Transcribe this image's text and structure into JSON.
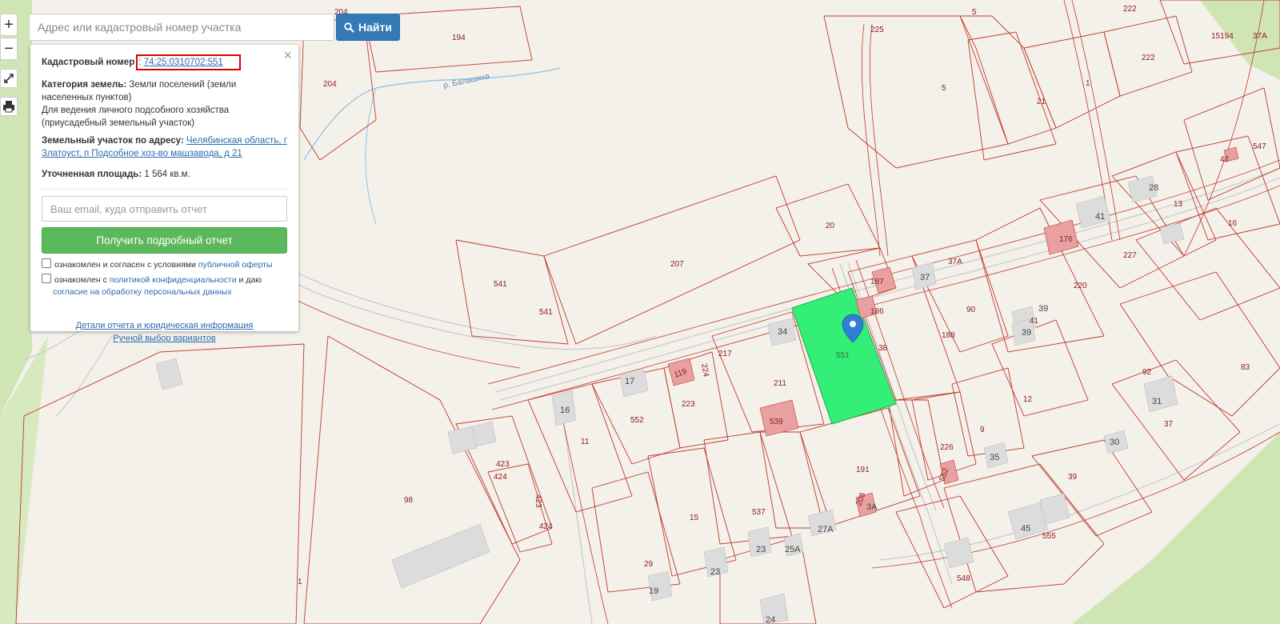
{
  "search": {
    "placeholder": "Адрес или кадастровый номер участка",
    "button_label": "Найти"
  },
  "controls": {
    "zoom_in": "+",
    "zoom_out": "−"
  },
  "panel": {
    "close_symbol": "×",
    "cadastral_label": "Кадастровый номер",
    "cadastral_number": "74:25:0310702:551",
    "land_category_label": "Категория земель:",
    "land_category_value": "Земли поселений (земли населенных пунктов)",
    "land_use": "Для ведения личного подсобного хозяйства (приусадебный земельный участок)",
    "address_label": "Земельный участок по адресу:",
    "address_link": "Челябинская область, г Златоуст, п Подсобное хоз-во машзавода, д 21",
    "area_label": "Уточненная площадь:",
    "area_value": "1 564 кв.м.",
    "email_placeholder": "Ваш email, куда отправить отчет",
    "report_button": "Получить подробный отчет",
    "consent1_text": "ознакомлен и согласен с условиями",
    "consent1_link": "публичной оферты",
    "consent2_text_a": "ознакомлен с",
    "consent2_link_a": "политикой конфиденциальности",
    "consent2_text_b": "и даю",
    "consent2_link_b": "согласие на обработку персональных данных",
    "details_link": "Детали отчета и юридическая информация",
    "manual_link": "Ручной выбор вариантов"
  },
  "map": {
    "river_label": "р. Балашиха",
    "highlight_color": "#33ee77",
    "selected_plot": "551",
    "plot_labels": [
      "194",
      "204",
      "204",
      "225",
      "5",
      "5",
      "222",
      "222",
      "15194",
      "37А",
      "1",
      "21",
      "547",
      "42",
      "541",
      "541",
      "207",
      "20",
      "187",
      "186",
      "34",
      "37",
      "37А",
      "90",
      "188",
      "38",
      "551",
      "220",
      "227",
      "16",
      "13",
      "28",
      "41",
      "176",
      "39",
      "39",
      "41",
      "211",
      "217",
      "224",
      "119",
      "17",
      "223",
      "16",
      "552",
      "11",
      "539",
      "423",
      "424",
      "423",
      "424",
      "98",
      "1",
      "12",
      "9",
      "226",
      "552",
      "35",
      "30",
      "31",
      "37",
      "92",
      "83",
      "191",
      "208",
      "3А",
      "27А",
      "25А",
      "537",
      "23",
      "23",
      "15",
      "29",
      "19",
      "24",
      "548",
      "555",
      "45",
      "39"
    ],
    "building_labels": [
      "34",
      "37",
      "17",
      "16",
      "39",
      "39",
      "41",
      "28",
      "13",
      "41",
      "35",
      "30",
      "31",
      "45",
      "23",
      "23",
      "19",
      "27А",
      "25А",
      "24"
    ]
  }
}
